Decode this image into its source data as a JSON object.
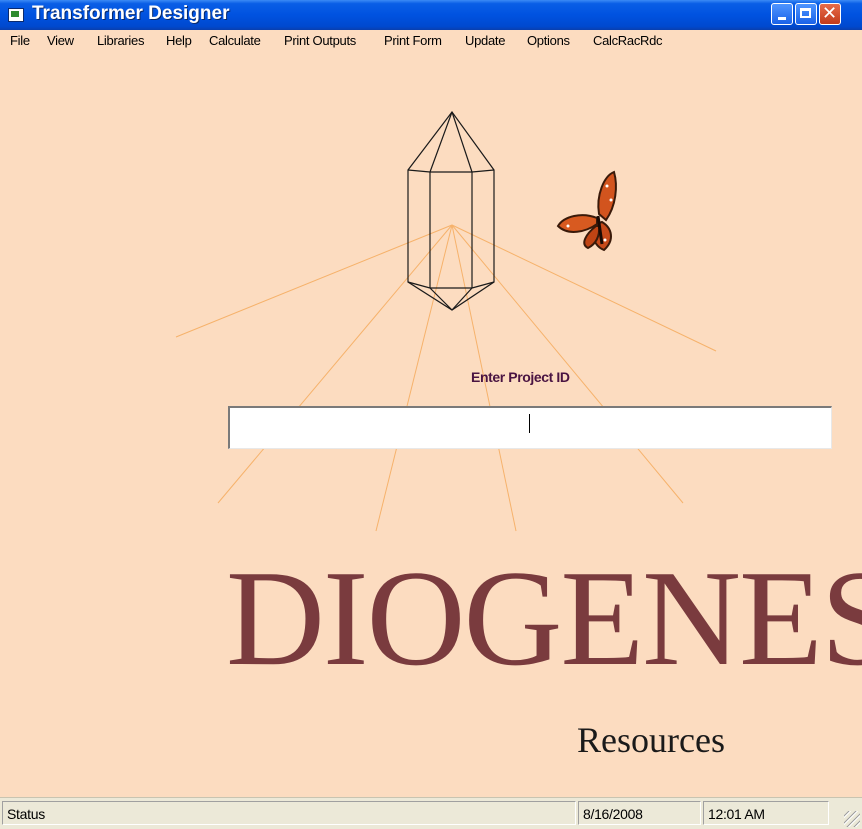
{
  "window": {
    "title": "Transformer Designer",
    "icons": {
      "app": "app-icon",
      "minimize": "minimize-icon",
      "maximize": "maximize-icon",
      "close": "close-icon"
    }
  },
  "menu": {
    "items": [
      "File",
      "View",
      "Libraries",
      "Help",
      "Calculate",
      "Print Outputs",
      "Print Form",
      "Update",
      "Options",
      "CalcRacRdc"
    ]
  },
  "main": {
    "prompt_label": "Enter Project ID",
    "project_id_value": "",
    "brand": "DIOGENES",
    "subbrand": "Resources",
    "images": {
      "crystal": "crystal-drawing",
      "butterfly": "butterfly-image"
    }
  },
  "status": {
    "text": "Status",
    "date": "8/16/2008",
    "time": "12:01 AM"
  },
  "colors": {
    "background": "#fcdcc0",
    "brand": "#7a3b3e",
    "prompt": "#4a1442",
    "rays": "#f6b26b"
  }
}
